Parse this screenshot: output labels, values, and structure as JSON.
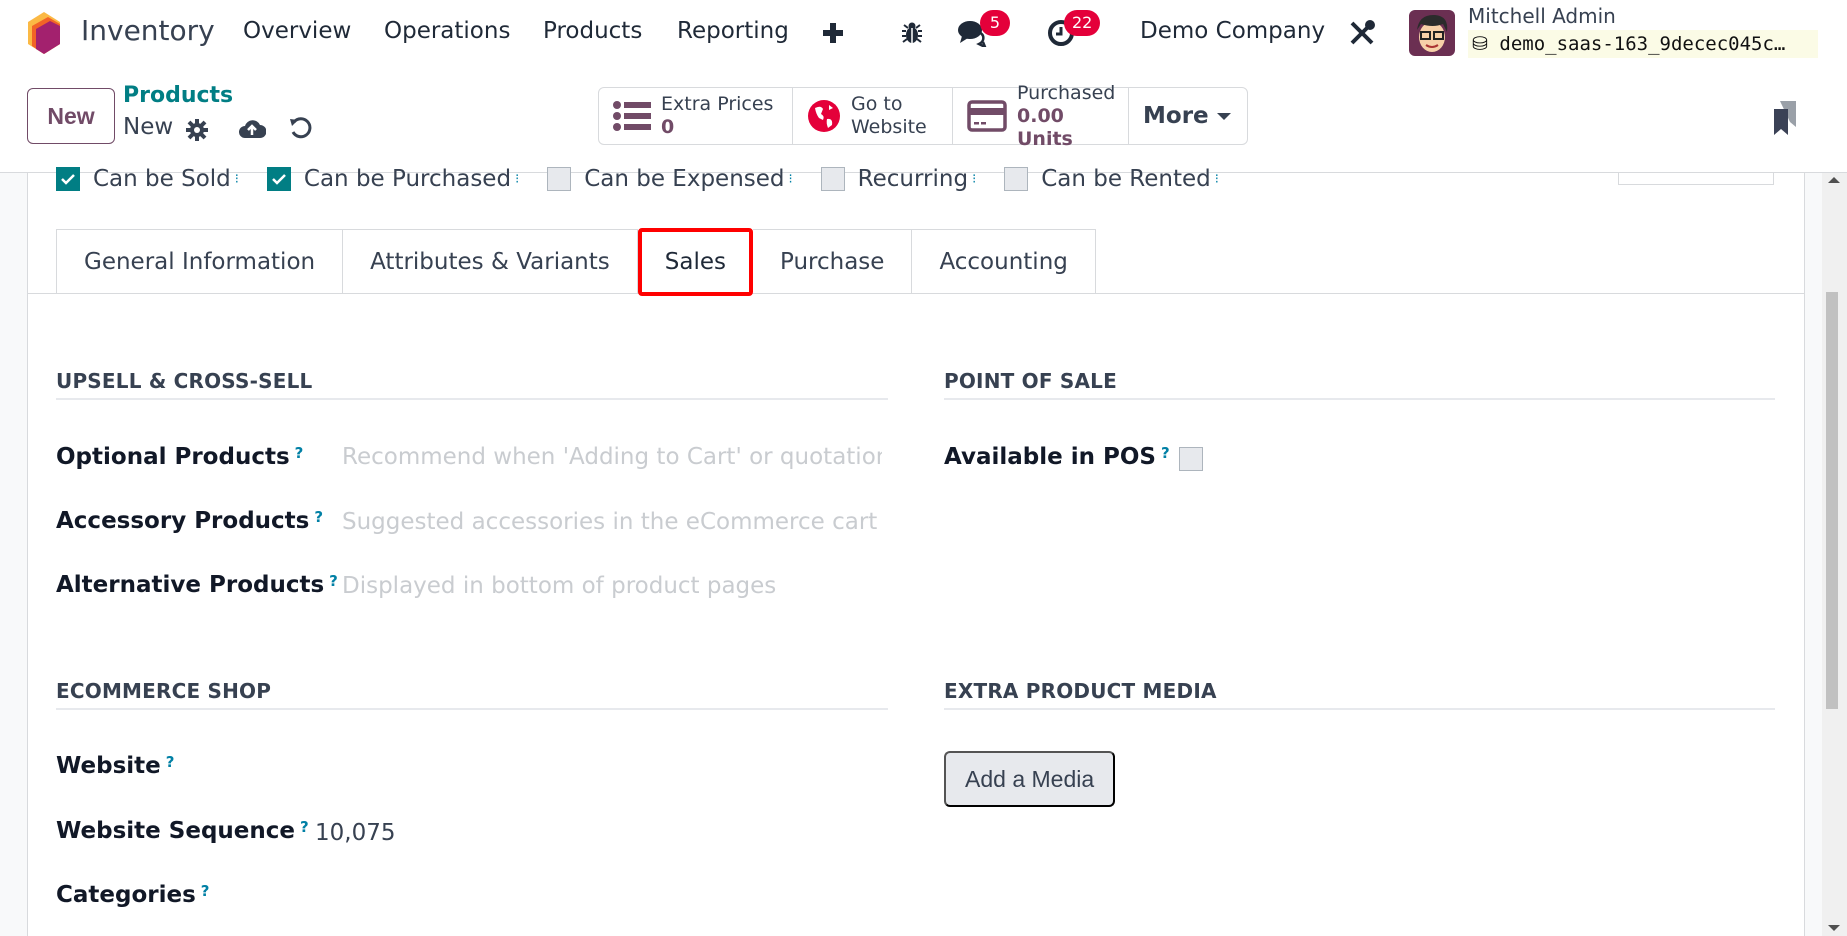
{
  "navbar": {
    "app_name": "Inventory",
    "menu": [
      "Overview",
      "Operations",
      "Products",
      "Reporting"
    ],
    "messages_badge": "5",
    "activities_badge": "22",
    "company": "Demo Company",
    "user_name": "Mitchell Admin",
    "database": "demo_saas-163_9decec045c…"
  },
  "control_panel": {
    "new_button": "New",
    "breadcrumb_parent": "Products",
    "breadcrumb_current": "New",
    "smart_buttons": [
      {
        "label": "Extra Prices",
        "value": "0",
        "icon": "list-icon"
      },
      {
        "label": "Go to",
        "label2": "Website",
        "icon": "globe-icon"
      },
      {
        "label": "Purchased",
        "value": "0.00 Units",
        "icon": "credit-card-icon"
      }
    ],
    "more_label": "More"
  },
  "checkboxes": [
    {
      "label": "Can be Sold",
      "checked": true
    },
    {
      "label": "Can be Purchased",
      "checked": true
    },
    {
      "label": "Can be Expensed",
      "checked": false
    },
    {
      "label": "Recurring",
      "checked": false
    },
    {
      "label": "Can be Rented",
      "checked": false
    }
  ],
  "tabs": [
    {
      "label": "General Information",
      "active": false
    },
    {
      "label": "Attributes & Variants",
      "active": false
    },
    {
      "label": "Sales",
      "active": true
    },
    {
      "label": "Purchase",
      "active": false
    },
    {
      "label": "Accounting",
      "active": false
    }
  ],
  "sales_tab": {
    "upsell": {
      "title": "UPSELL & CROSS-SELL",
      "fields": [
        {
          "label": "Optional Products",
          "placeholder": "Recommend when 'Adding to Cart' or quotation"
        },
        {
          "label": "Accessory Products",
          "placeholder": "Suggested accessories in the eCommerce cart"
        },
        {
          "label": "Alternative Products",
          "placeholder": "Displayed in bottom of product pages"
        }
      ]
    },
    "pos": {
      "title": "POINT OF SALE",
      "available_label": "Available in POS",
      "available": false
    },
    "ecommerce": {
      "title": "ECOMMERCE SHOP",
      "website_label": "Website",
      "website_value": "",
      "sequence_label": "Website Sequence",
      "sequence_value": "10,075",
      "categories_label": "Categories"
    },
    "media": {
      "title": "EXTRA PRODUCT MEDIA",
      "add_button": "Add a Media"
    },
    "help_mark": "?"
  },
  "colors": {
    "brand": "#714b67",
    "teal": "#017e84",
    "badge": "#e4003a",
    "highlight": "#ff0000"
  }
}
